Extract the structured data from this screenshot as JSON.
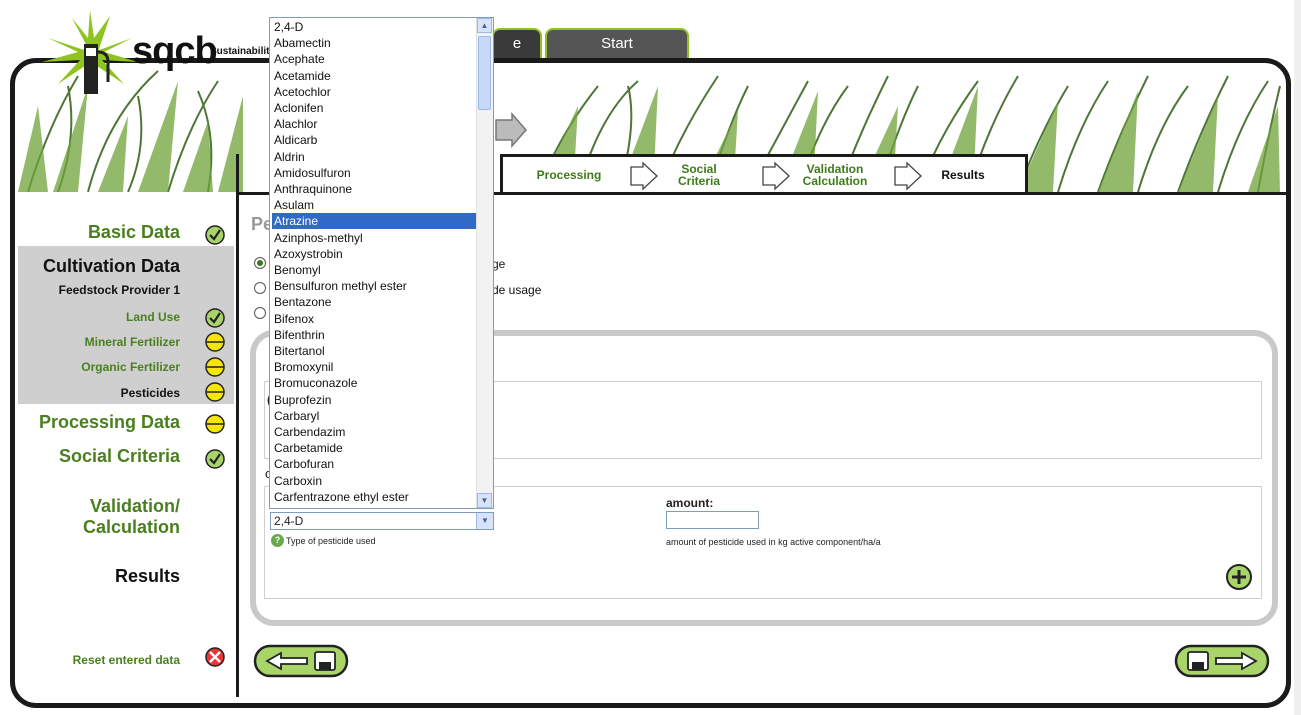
{
  "logo": {
    "text": "sqcb",
    "subtext": "Sustainability"
  },
  "top_tabs": {
    "partial_label": "e",
    "start_label": "Start"
  },
  "steps": [
    {
      "label": "Processing"
    },
    {
      "label": "Social\nCriteria"
    },
    {
      "label": "Validation\nCalculation"
    },
    {
      "label": "Results"
    }
  ],
  "sidebar": {
    "basic_data": "Basic Data",
    "cultivation_data": "Cultivation Data",
    "feedstock_provider": "Feedstock Provider 1",
    "land_use": "Land Use",
    "mineral_fertilizer": "Mineral Fertilizer",
    "organic_fertilizer": "Organic Fertilizer",
    "pesticides": "Pesticides",
    "processing_data": "Processing Data",
    "social_criteria": "Social Criteria",
    "validation_calculation": "Validation/\nCalculation",
    "results": "Results",
    "reset": "Reset entered data"
  },
  "main": {
    "title_partial": "Pe",
    "radio_options": [
      {
        "text": "ge",
        "checked": true
      },
      {
        "text": "de usage",
        "checked": false
      },
      {
        "text": "",
        "checked": false
      }
    ],
    "amount_label": "amount:",
    "amount_value": "",
    "amount_hint": "amount of pesticide used in kg active component/ha/a",
    "type_hint": "Type of pesticide used",
    "select_value": "2,4-D",
    "partial_letter_1": "(",
    "partial_letter_2": "o"
  },
  "dropdown": {
    "selected": "Atrazine",
    "options": [
      "2,4-D",
      "Abamectin",
      "Acephate",
      "Acetamide",
      "Acetochlor",
      "Aclonifen",
      "Alachlor",
      "Aldicarb",
      "Aldrin",
      "Amidosulfuron",
      "Anthraquinone",
      "Asulam",
      "Atrazine",
      "Azinphos-methyl",
      "Azoxystrobin",
      "Benomyl",
      "Bensulfuron methyl ester",
      "Bentazone",
      "Bifenox",
      "Bifenthrin",
      "Bitertanol",
      "Bromoxynil",
      "Bromuconazole",
      "Buprofezin",
      "Carbaryl",
      "Carbendazim",
      "Carbetamide",
      "Carbofuran",
      "Carboxin",
      "Carfentrazone ethyl ester"
    ]
  },
  "colors": {
    "brand_green": "#8fc31f",
    "label_green": "#4a7f1f",
    "selection_blue": "#316ac5",
    "frame": "#1a1a1a"
  },
  "icons": {
    "complete": "check-circle-icon",
    "partial": "half-circle-icon",
    "reset": "red-x-icon",
    "add": "plus-circle-icon",
    "help": "question-icon",
    "back": "back-save-icon",
    "forward": "save-forward-icon"
  }
}
